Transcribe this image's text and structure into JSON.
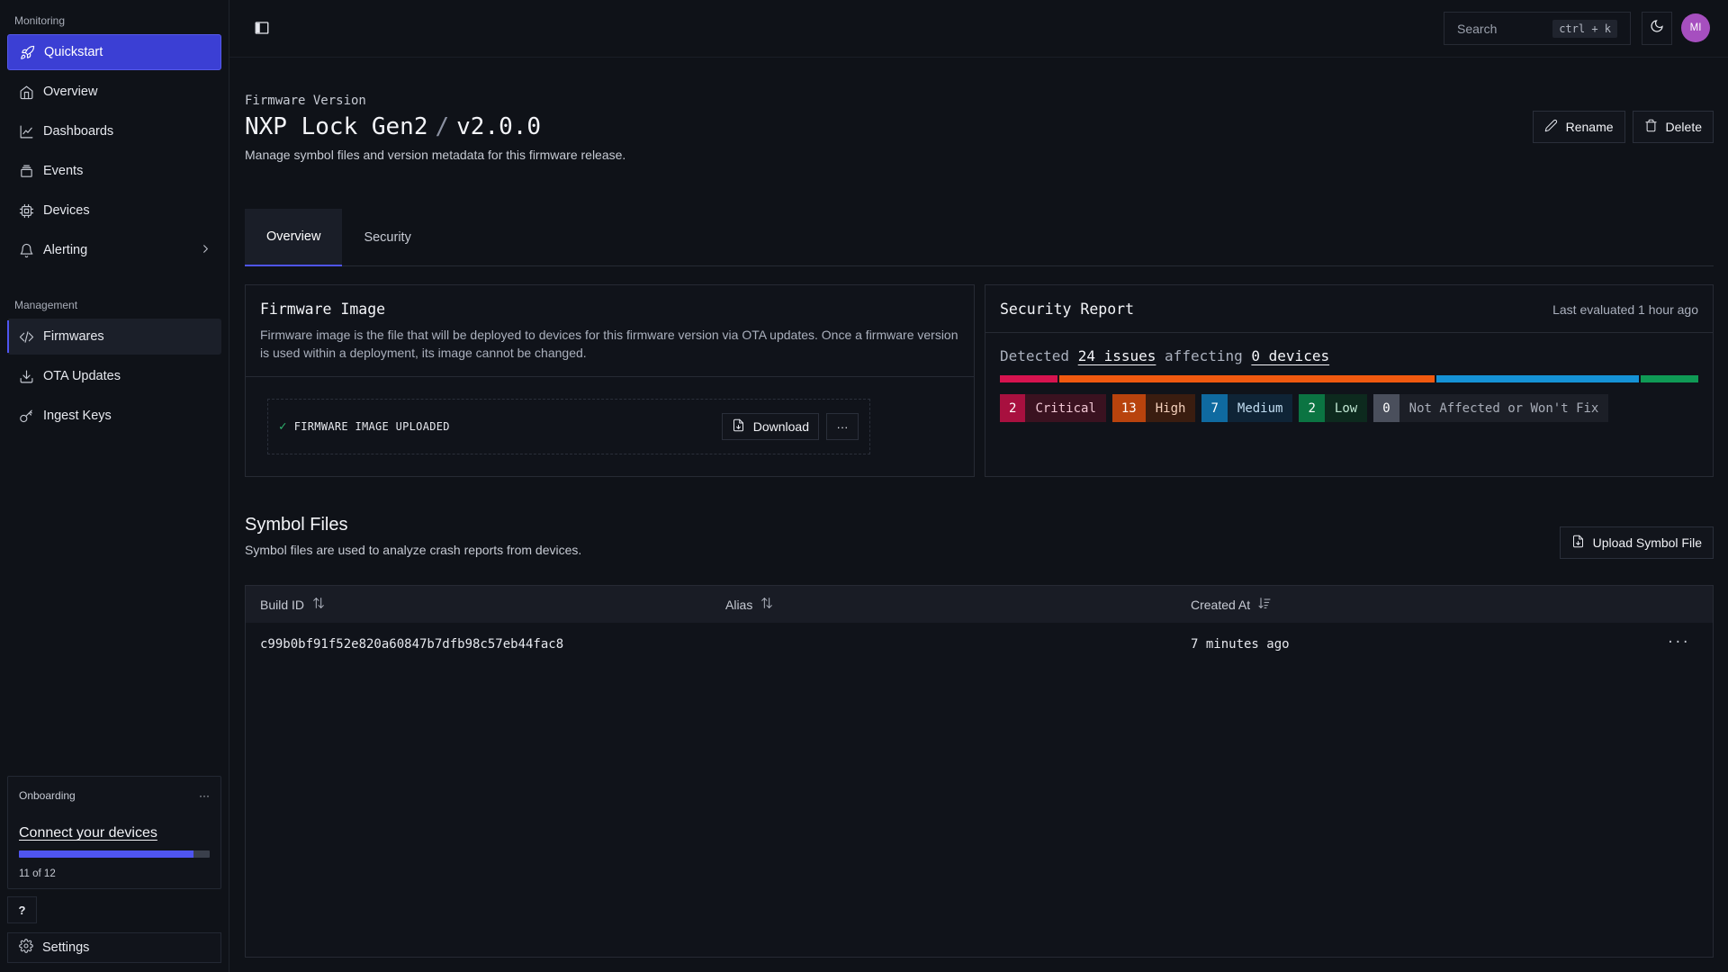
{
  "sidebar": {
    "monitoring_label": "Monitoring",
    "monitoring_items": [
      {
        "label": "Quickstart",
        "icon": "rocket-icon"
      },
      {
        "label": "Overview",
        "icon": "home-icon"
      },
      {
        "label": "Dashboards",
        "icon": "chart-line-icon"
      },
      {
        "label": "Events",
        "icon": "layers-icon"
      },
      {
        "label": "Devices",
        "icon": "cpu-icon"
      },
      {
        "label": "Alerting",
        "icon": "bell-icon"
      }
    ],
    "management_label": "Management",
    "management_items": [
      {
        "label": "Firmwares",
        "icon": "code-icon"
      },
      {
        "label": "OTA Updates",
        "icon": "download-icon"
      },
      {
        "label": "Ingest Keys",
        "icon": "key-icon"
      }
    ],
    "onboarding": {
      "label": "Onboarding",
      "title": "Connect your devices",
      "progress_text": "11 of 12",
      "progress_fraction": 0.9167
    },
    "help_label": "?",
    "settings_label": "Settings"
  },
  "topbar": {
    "search_placeholder": "Search",
    "search_shortcut": "ctrl + k",
    "avatar_initials": "MI"
  },
  "page": {
    "eyebrow": "Firmware Version",
    "title_product": "NXP Lock Gen2",
    "title_sep": "/",
    "title_version": "v2.0.0",
    "subtitle": "Manage symbol files and version metadata for this firmware release.",
    "rename_label": "Rename",
    "delete_label": "Delete"
  },
  "tabs": [
    {
      "label": "Overview",
      "active": true
    },
    {
      "label": "Security",
      "active": false
    }
  ],
  "firmware_image": {
    "title": "Firmware Image",
    "description": "Firmware image is the file that will be deployed to devices for this firmware version via OTA updates. Once a firmware version is used within a deployment, its image cannot be changed.",
    "status": "FIRMWARE IMAGE UPLOADED",
    "download_label": "Download",
    "more_label": "···"
  },
  "security_report": {
    "title": "Security Report",
    "last_evaluated": "Last evaluated 1 hour ago",
    "detected_prefix": "Detected",
    "issues_text": "24 issues",
    "affecting_text": "affecting",
    "devices_text": "0 devices",
    "severities": [
      {
        "count": "2",
        "label": "Critical",
        "value": 2,
        "color": "#d6134f",
        "num_bg": "#a8103f",
        "label_bg": "#3a1220",
        "label_color": "#f2c7d4"
      },
      {
        "count": "13",
        "label": "High",
        "value": 13,
        "color": "#f0590f",
        "num_bg": "#b8430d",
        "label_bg": "#3a1d10",
        "label_color": "#f5d1bd"
      },
      {
        "count": "7",
        "label": "Medium",
        "value": 7,
        "color": "#1592d6",
        "num_bg": "#0f6aa0",
        "label_bg": "#0f2436",
        "label_color": "#c0dcf0"
      },
      {
        "count": "2",
        "label": "Low",
        "value": 2,
        "color": "#0f9a55",
        "num_bg": "#0b7442",
        "label_bg": "#0d2a1e",
        "label_color": "#bfe6d2"
      },
      {
        "count": "0",
        "label": "Not Affected or Won't Fix",
        "value": 0,
        "color": "#6b7080",
        "num_bg": "#4a4f5c",
        "label_bg": "#1c1f27",
        "label_color": "#a8adb8"
      }
    ]
  },
  "symbol_files": {
    "title": "Symbol Files",
    "subtitle": "Symbol files are used to analyze crash reports from devices.",
    "upload_label": "Upload Symbol File",
    "columns": [
      "Build ID",
      "Alias",
      "Created At"
    ],
    "rows": [
      {
        "build_id": "c99b0bf91f52e820a60847b7dfb98c57eb44fac8",
        "alias": "",
        "created_at": "7 minutes ago"
      }
    ]
  },
  "colors": {
    "accent": "#4f55f0",
    "active_nav": "#3b3fd4",
    "background": "#0f1218"
  }
}
